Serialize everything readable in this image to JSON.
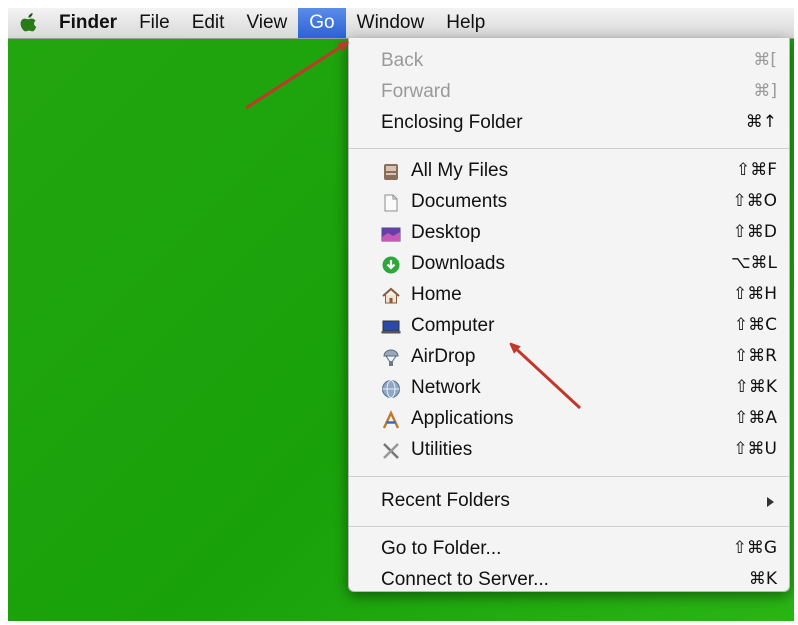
{
  "menubar": {
    "apple_icon": "apple-logo-icon",
    "items": [
      {
        "label": "Finder"
      },
      {
        "label": "File"
      },
      {
        "label": "Edit"
      },
      {
        "label": "View"
      },
      {
        "label": "Go"
      },
      {
        "label": "Window"
      },
      {
        "label": "Help"
      }
    ],
    "active_item": "Go"
  },
  "go_menu": {
    "nav": [
      {
        "label": "Back",
        "shortcut": "⌘[",
        "enabled": false
      },
      {
        "label": "Forward",
        "shortcut": "⌘]",
        "enabled": false
      },
      {
        "label": "Enclosing Folder",
        "shortcut": "⌘↑",
        "enabled": true
      }
    ],
    "places": [
      {
        "label": "All My Files",
        "shortcut": "⇧⌘F",
        "icon": "all-my-files-icon"
      },
      {
        "label": "Documents",
        "shortcut": "⇧⌘O",
        "icon": "documents-icon"
      },
      {
        "label": "Desktop",
        "shortcut": "⇧⌘D",
        "icon": "desktop-icon"
      },
      {
        "label": "Downloads",
        "shortcut": "⌥⌘L",
        "icon": "downloads-icon"
      },
      {
        "label": "Home",
        "shortcut": "⇧⌘H",
        "icon": "home-icon"
      },
      {
        "label": "Computer",
        "shortcut": "⇧⌘C",
        "icon": "computer-icon"
      },
      {
        "label": "AirDrop",
        "shortcut": "⇧⌘R",
        "icon": "airdrop-icon"
      },
      {
        "label": "Network",
        "shortcut": "⇧⌘K",
        "icon": "network-icon"
      },
      {
        "label": "Applications",
        "shortcut": "⇧⌘A",
        "icon": "applications-icon"
      },
      {
        "label": "Utilities",
        "shortcut": "⇧⌘U",
        "icon": "utilities-icon"
      }
    ],
    "recent": {
      "label": "Recent Folders",
      "submenu_icon": "submenu-arrow-icon"
    },
    "actions": [
      {
        "label": "Go to Folder...",
        "shortcut": "⇧⌘G"
      },
      {
        "label": "Connect to Server...",
        "shortcut": "⌘K"
      }
    ]
  },
  "annotations": [
    {
      "name": "arrow-to-go-menu",
      "color": "#c0392b"
    },
    {
      "name": "arrow-to-computer",
      "color": "#c0392b"
    }
  ],
  "colors": {
    "desktop": "#1ea80c",
    "menu_highlight": "#2e62d6",
    "arrow": "#c0392b"
  }
}
